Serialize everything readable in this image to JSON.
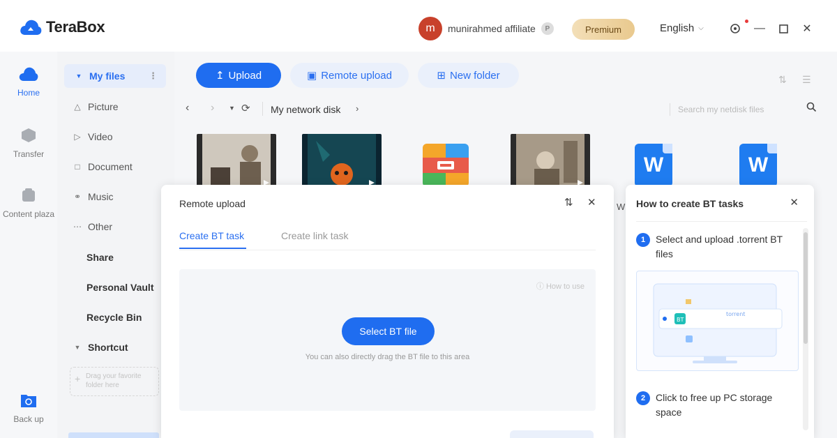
{
  "app": {
    "name": "TeraBox"
  },
  "user": {
    "avatar_letter": "m",
    "name": "munirahmed affiliate",
    "badge": "P",
    "premium_label": "Premium",
    "language": "English"
  },
  "colors": {
    "accent": "#1f6df0",
    "avatar": "#c8412b",
    "premium": "#e9c98e",
    "notification": "#e83a3a"
  },
  "rail": {
    "items": [
      {
        "label": "Home",
        "icon": "cloud-icon",
        "active": true
      },
      {
        "label": "Transfer",
        "icon": "transfer-icon",
        "active": false
      },
      {
        "label": "Content plaza",
        "icon": "content-plaza-icon",
        "active": false
      },
      {
        "label": "Back up",
        "icon": "backup-icon",
        "active": false
      }
    ]
  },
  "sidebar": {
    "my_files": "My files",
    "items": [
      {
        "label": "Picture",
        "icon": "picture-icon"
      },
      {
        "label": "Video",
        "icon": "video-icon"
      },
      {
        "label": "Document",
        "icon": "document-icon"
      },
      {
        "label": "Music",
        "icon": "music-icon"
      },
      {
        "label": "Other",
        "icon": "other-icon"
      }
    ],
    "share": "Share",
    "vault": "Personal Vault",
    "recycle": "Recycle Bin",
    "shortcut": "Shortcut",
    "shortcut_hint": "Drag your favorite folder here"
  },
  "toolbar": {
    "upload": "Upload",
    "remote_upload": "Remote upload",
    "new_folder": "New folder"
  },
  "nav": {
    "breadcrumb": "My network disk",
    "search_placeholder": "Search my netdisk files"
  },
  "files": {
    "edge_letter": "W"
  },
  "remote_dialog": {
    "title": "Remote upload",
    "tabs": [
      "Create BT task",
      "Create link task"
    ],
    "how_to_use": "How to use",
    "select_button": "Select BT file",
    "drop_hint": "You can also directly drag the BT file to this area"
  },
  "help_panel": {
    "title": "How to create BT tasks",
    "steps": [
      {
        "num": "1",
        "text": "Select and upload .torrent BT files"
      },
      {
        "num": "2",
        "text": "Click to free up PC storage space"
      }
    ],
    "illus_label": "torrent",
    "illus_badge": "BT"
  }
}
